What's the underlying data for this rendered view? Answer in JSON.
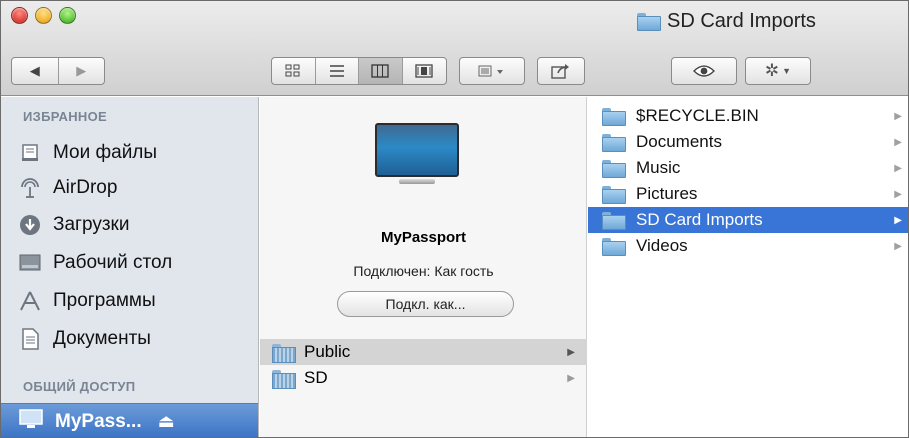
{
  "window": {
    "title": "SD Card Imports"
  },
  "toolbar": {
    "back_icon": "back-arrow-icon",
    "forward_icon": "forward-arrow-icon",
    "view_modes": [
      "icon-view",
      "list-view",
      "column-view",
      "cover-flow-view"
    ],
    "active_view": "column-view",
    "arrange_icon": "arrange-icon",
    "share_icon": "share-icon",
    "quicklook_icon": "eye-icon",
    "action_icon": "gear-icon"
  },
  "sidebar": {
    "favorites_heading": "ИЗБРАННОЕ",
    "items": [
      {
        "label": "Мои файлы",
        "icon": "all-files-icon"
      },
      {
        "label": "AirDrop",
        "icon": "airdrop-icon"
      },
      {
        "label": "Загрузки",
        "icon": "downloads-icon"
      },
      {
        "label": "Рабочий стол",
        "icon": "desktop-icon"
      },
      {
        "label": "Программы",
        "icon": "applications-icon"
      },
      {
        "label": "Документы",
        "icon": "documents-icon"
      }
    ],
    "shared_heading": "ОБЩИЙ ДОСТУП",
    "shared_selected": {
      "label": "MyPass...",
      "eject": "⏏"
    }
  },
  "device_panel": {
    "name": "MyPassport",
    "status": "Подключен: Как гость",
    "connect_button": "Подкл. как...",
    "folders": [
      {
        "name": "Public",
        "highlighted": true
      },
      {
        "name": "SD",
        "highlighted": false
      }
    ]
  },
  "folder_column": {
    "items": [
      {
        "name": "$RECYCLE.BIN",
        "selected": false
      },
      {
        "name": "Documents",
        "selected": false
      },
      {
        "name": "Music",
        "selected": false
      },
      {
        "name": "Pictures",
        "selected": false
      },
      {
        "name": "SD Card Imports",
        "selected": true
      },
      {
        "name": "Videos",
        "selected": false
      }
    ]
  },
  "colors": {
    "selection": "#3875d7",
    "sidebar_bg": "#e1e6ed"
  }
}
